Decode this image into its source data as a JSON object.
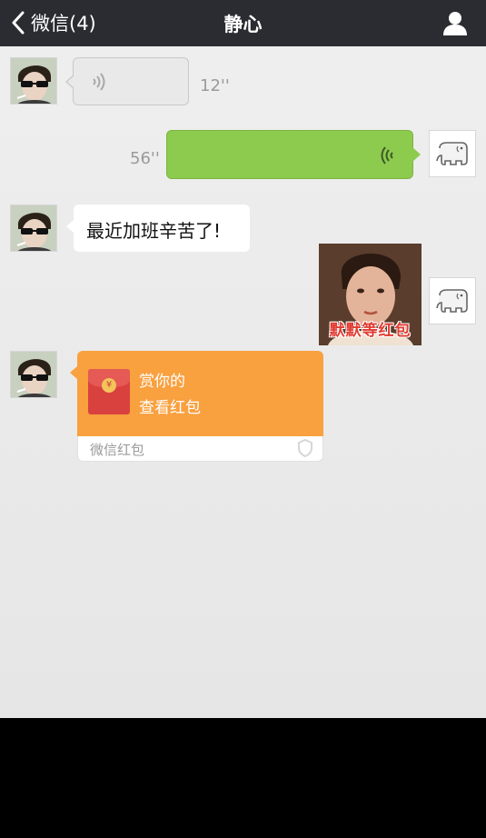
{
  "header": {
    "back_label": "微信(4)",
    "title": "静心"
  },
  "messages": {
    "voice_in": {
      "duration": "12''"
    },
    "voice_out": {
      "duration": "56''"
    },
    "text_in": {
      "text": "最近加班辛苦了!"
    },
    "sticker": {
      "caption": "默默等红包"
    },
    "red_packet": {
      "line1": "赏你的",
      "line2": "查看红包",
      "brand": "微信红包",
      "coin_symbol": "¥"
    }
  },
  "colors": {
    "header_bg": "#2a2c31",
    "chat_bg": "#ebebeb",
    "outgoing_bubble": "#8ccb4e",
    "red_packet": "#f9a03f"
  },
  "icons": [
    "chevron-left-icon",
    "user-icon",
    "voice-wave-icon",
    "elephant-avatar-icon",
    "shield-icon"
  ]
}
